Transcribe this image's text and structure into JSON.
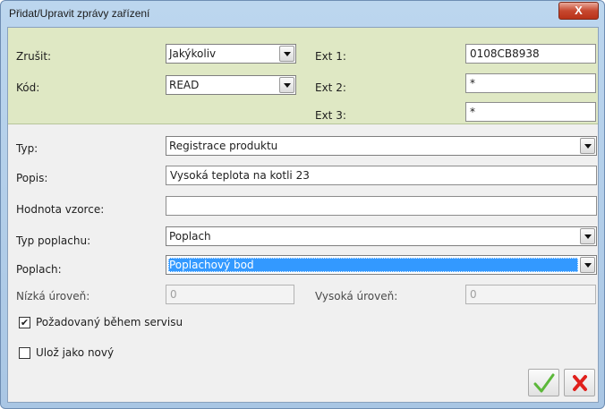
{
  "window": {
    "title": "Přidat/Upravit zprávy zařízení",
    "close_label": "X"
  },
  "top": {
    "zrusit_label": "Zrušit:",
    "zrusit_value": "Jakýkoliv",
    "kod_label": "Kód:",
    "kod_value": "READ",
    "ext1_label": "Ext 1:",
    "ext1_value": "0108CB8938",
    "ext2_label": "Ext 2:",
    "ext2_value": "*",
    "ext3_label": "Ext 3:",
    "ext3_value": "*"
  },
  "form": {
    "typ_label": "Typ:",
    "typ_value": "Registrace produktu",
    "popis_label": "Popis:",
    "popis_value": "Vysoká teplota na kotli 23",
    "hodnota_label": "Hodnota vzorce:",
    "hodnota_value": "",
    "typ_poplachu_label": "Typ poplachu:",
    "typ_poplachu_value": "Poplach",
    "poplach_label": "Poplach:",
    "poplach_value": "Poplachový bod",
    "nizka_label": "Nízká úroveň:",
    "nizka_value": "0",
    "vysoka_label": "Vysoká úroveň:",
    "vysoka_value": "0",
    "pozadovany_label": "Požadovaný během servisu",
    "pozadovany_mark": "✔",
    "uloz_label": "Ulož jako nový",
    "uloz_mark": ""
  },
  "colors": {
    "ok_green": "#5cb83a",
    "cancel_red": "#e0201c",
    "top_bg": "#dfe8c4",
    "selection": "#3399ff"
  }
}
